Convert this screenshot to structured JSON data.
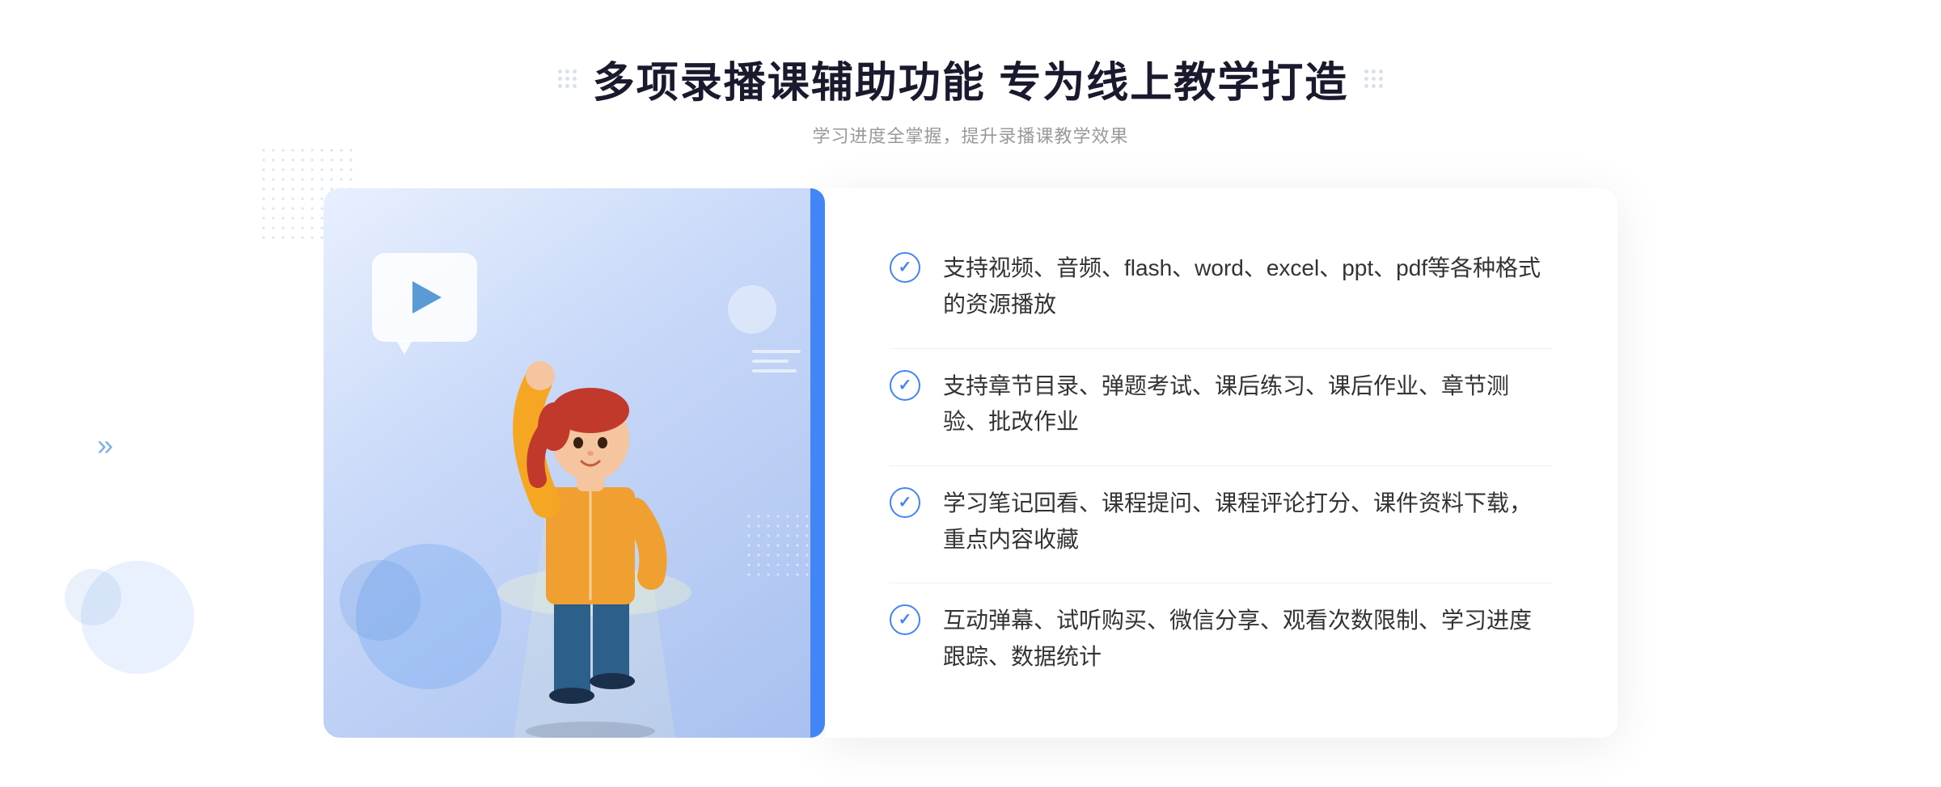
{
  "page": {
    "background": "#ffffff"
  },
  "header": {
    "main_title": "多项录播课辅助功能 专为线上教学打造",
    "subtitle": "学习进度全掌握，提升录播课教学效果"
  },
  "features": [
    {
      "id": 1,
      "text": "支持视频、音频、flash、word、excel、ppt、pdf等各种格式的资源播放"
    },
    {
      "id": 2,
      "text": "支持章节目录、弹题考试、课后练习、课后作业、章节测验、批改作业"
    },
    {
      "id": 3,
      "text": "学习笔记回看、课程提问、课程评论打分、课件资料下载，重点内容收藏"
    },
    {
      "id": 4,
      "text": "互动弹幕、试听购买、微信分享、观看次数限制、学习进度跟踪、数据统计"
    }
  ],
  "chevron": "»",
  "colors": {
    "primary": "#4285f4",
    "text_dark": "#1a1a2e",
    "text_medium": "#333333",
    "text_light": "#999999",
    "bg_gradient_start": "#e8f0fe",
    "bg_gradient_end": "#a8c0f0"
  }
}
